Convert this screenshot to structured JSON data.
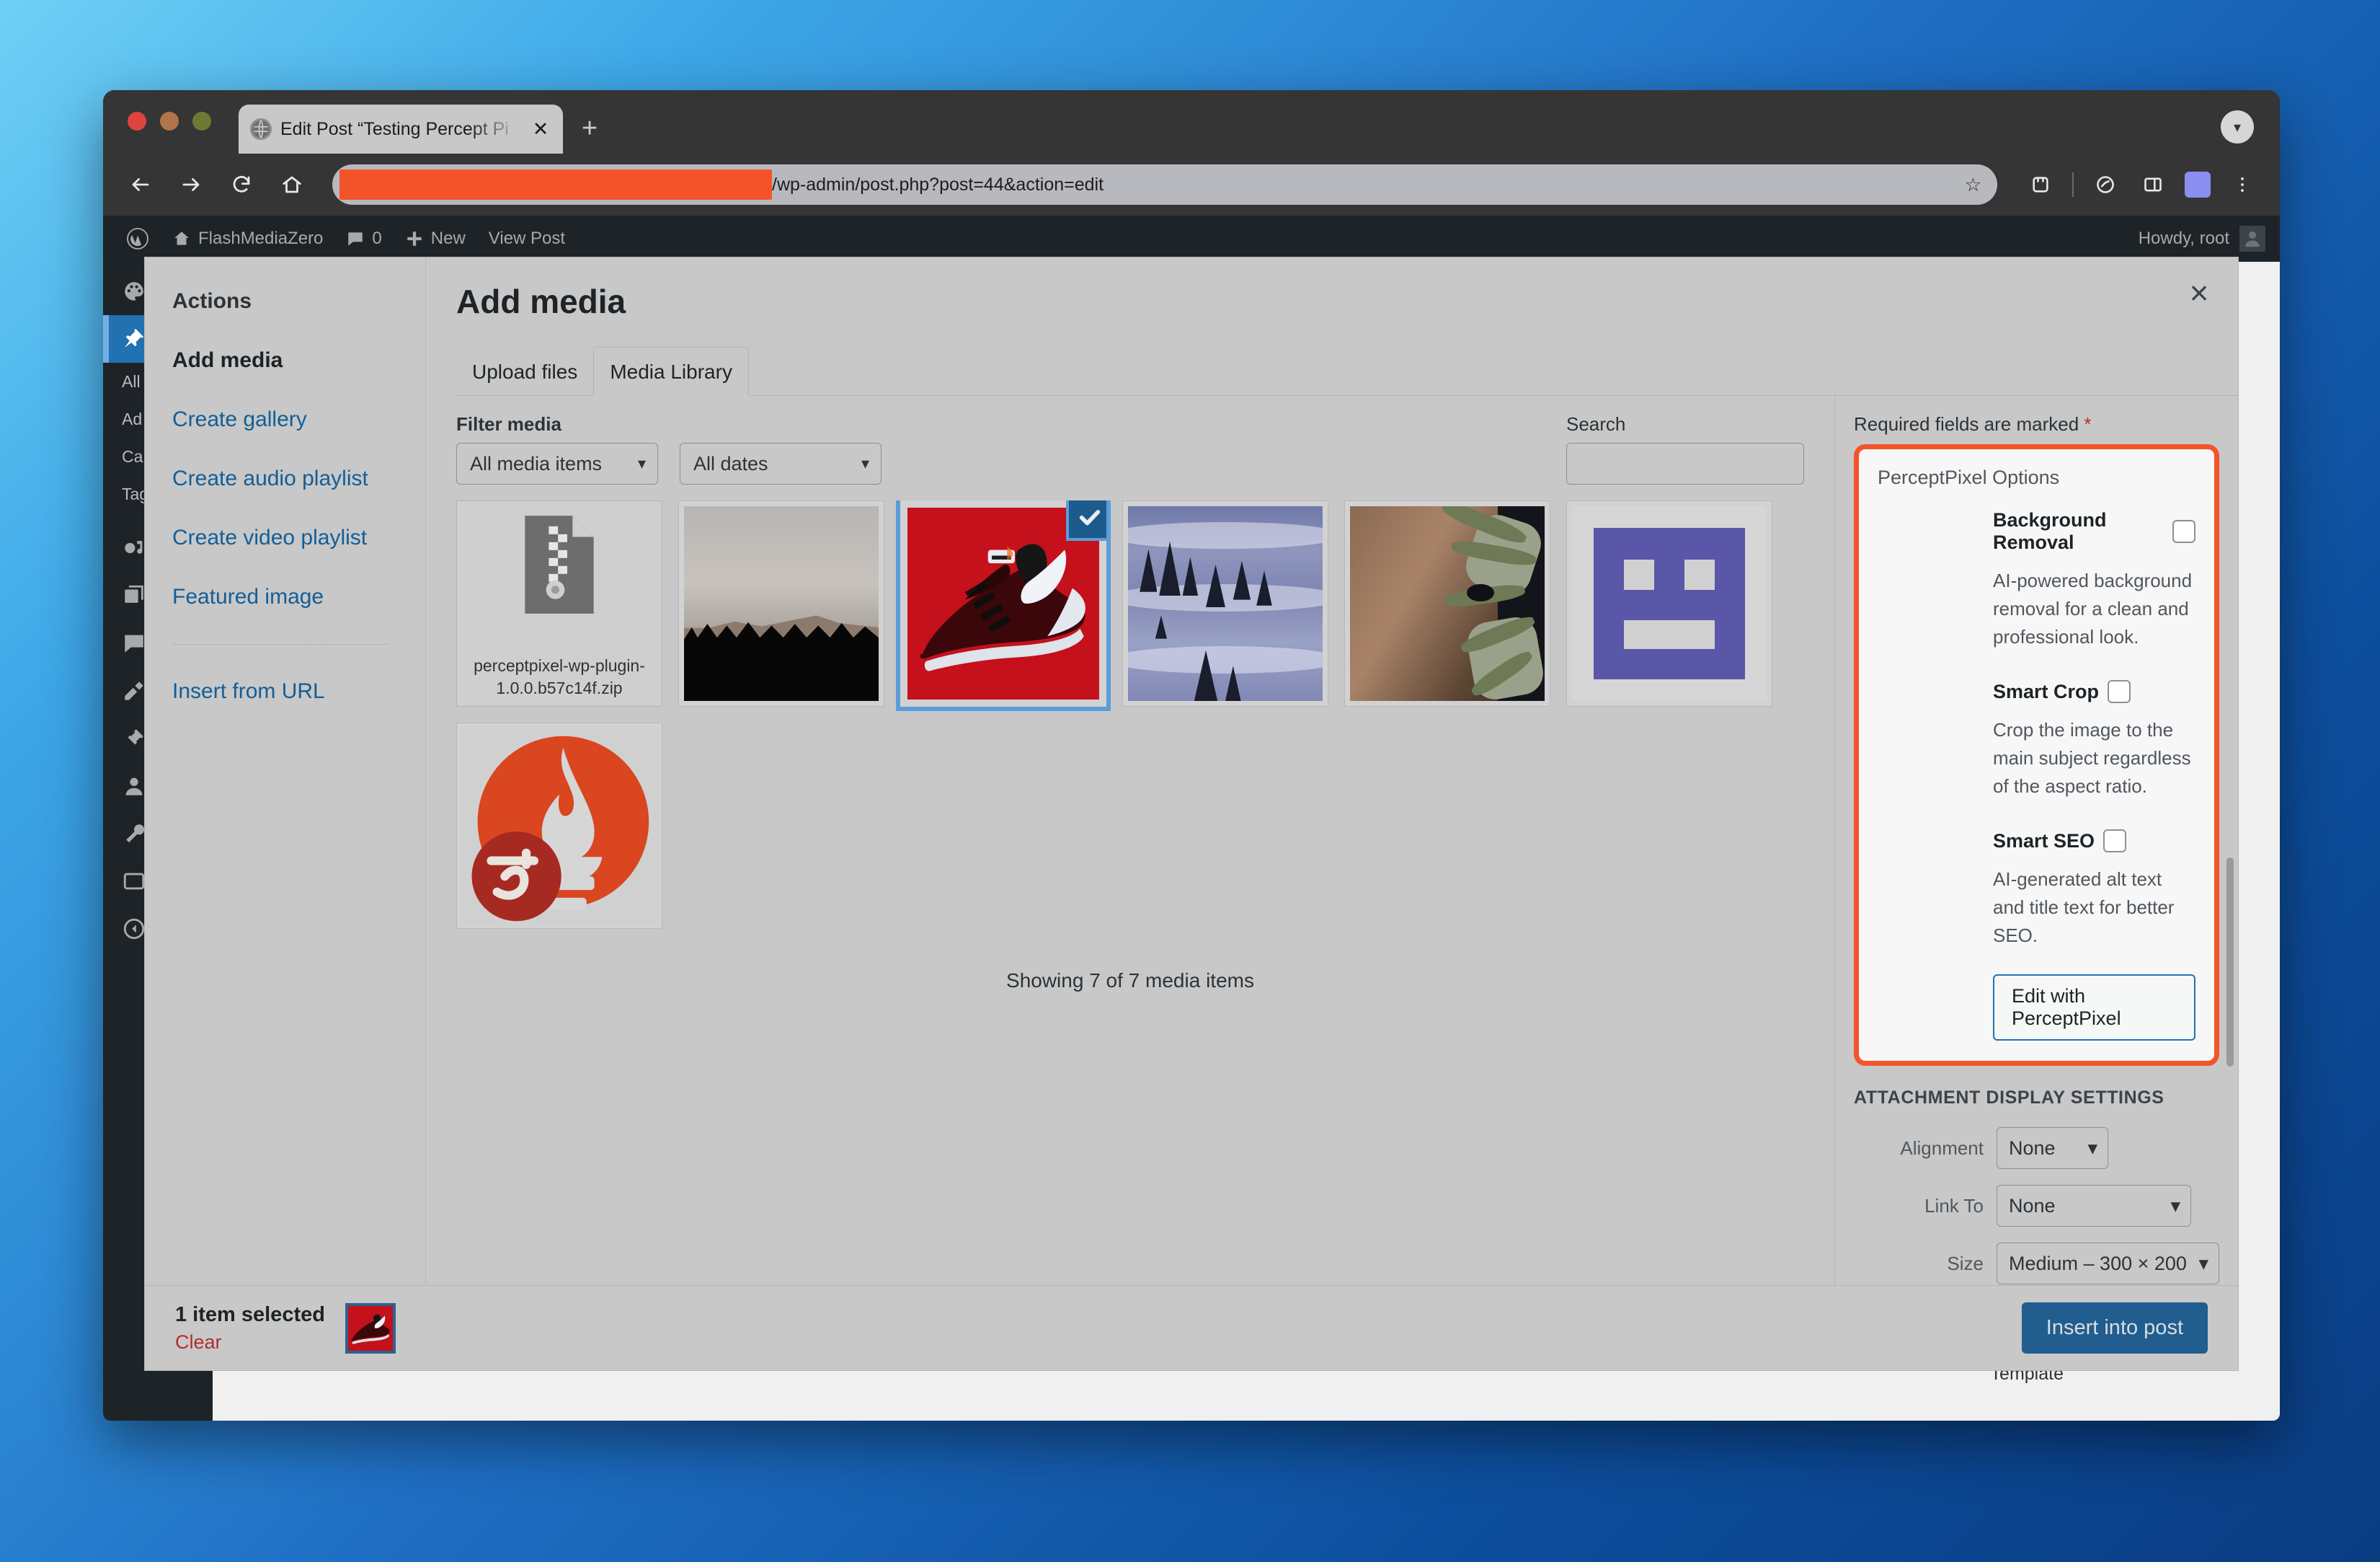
{
  "browser": {
    "tab_title": "Edit Post “Testing Percept Pi",
    "tab_close_label": "✕",
    "new_tab_label": "+",
    "url_visible": "/wp-admin/post.php?post=44&action=edit",
    "url_redacted": true,
    "star_glyph": "☆"
  },
  "adminbar": {
    "site_name": "FlashMediaZero",
    "comment_count": "0",
    "new_label": "New",
    "view_post_label": "View Post",
    "howdy": "Howdy, root"
  },
  "page": {
    "template_label": "Template"
  },
  "modal": {
    "title": "Add media",
    "close_label": "×",
    "menu_heading": "Actions",
    "menu_items": [
      {
        "label": "Add media",
        "active": true
      },
      {
        "label": "Create gallery",
        "active": false
      },
      {
        "label": "Create audio playlist",
        "active": false
      },
      {
        "label": "Create video playlist",
        "active": false
      },
      {
        "label": "Featured image",
        "active": false
      },
      {
        "label": "Insert from URL",
        "active": false
      }
    ],
    "tabs": [
      {
        "label": "Upload files",
        "active": false
      },
      {
        "label": "Media Library",
        "active": true
      }
    ],
    "filter_label": "Filter media",
    "filter_type_value": "All media items",
    "filter_date_value": "All dates",
    "search_label": "Search",
    "search_value": "",
    "search_placeholder": "",
    "showing_count": "Showing 7 of 7 media items",
    "attachments": [
      {
        "kind": "file",
        "filename": "perceptpixel-wp-plugin-1.0.0.b57c14f.zip",
        "selected": false
      },
      {
        "kind": "image-landscape-dark",
        "filename": "",
        "selected": false
      },
      {
        "kind": "image-shoe",
        "filename": "",
        "selected": true
      },
      {
        "kind": "image-snow-forest",
        "filename": "",
        "selected": false
      },
      {
        "kind": "image-portrait-branch",
        "filename": "",
        "selected": false
      },
      {
        "kind": "image-avatar-placeholder",
        "filename": "",
        "selected": false
      },
      {
        "kind": "image-fire-logo",
        "filename": "",
        "selected": false
      }
    ],
    "footer": {
      "selection_count": "1 item selected",
      "clear_label": "Clear",
      "insert_label": "Insert into post"
    }
  },
  "sidebar": {
    "required_note": "Required fields are marked",
    "required_marker": "*",
    "perceptpixel": {
      "heading": "PerceptPixel Options",
      "accent_color": "#f4542a",
      "options": [
        {
          "label": "Background Removal",
          "checked": false,
          "description": "AI-powered background removal for a clean and professional look."
        },
        {
          "label": "Smart Crop",
          "checked": false,
          "description": "Crop the image to the main subject regardless of the aspect ratio."
        },
        {
          "label": "Smart SEO",
          "checked": false,
          "description": "AI-generated alt text and title text for better SEO."
        }
      ],
      "edit_button_label": "Edit with PerceptPixel"
    },
    "display_settings": {
      "heading": "ATTACHMENT DISPLAY SETTINGS",
      "rows": [
        {
          "label": "Alignment",
          "value": "None"
        },
        {
          "label": "Link To",
          "value": "None"
        },
        {
          "label": "Size",
          "value": "Medium – 300 × 200"
        }
      ]
    }
  }
}
